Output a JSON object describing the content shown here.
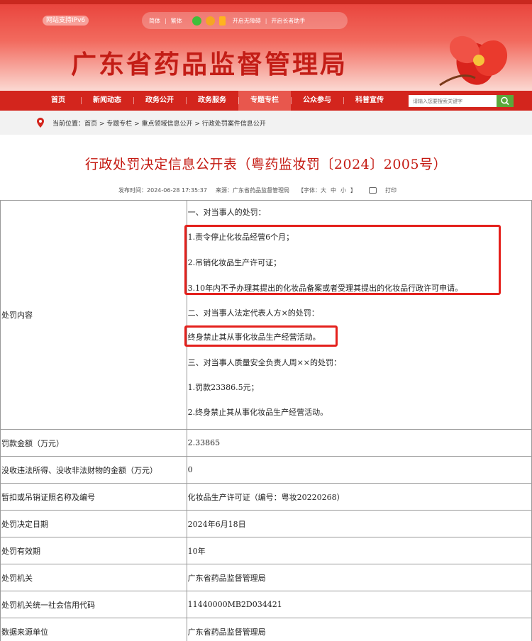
{
  "header": {
    "ipv6_badge": "网站支持IPv6",
    "lang_simplified": "简体",
    "lang_traditional": "繁体",
    "accessibility": "开启无障碍",
    "elder_mode": "开启长者助手",
    "site_title": "广东省药品监督管理局",
    "icons": [
      "wechat-icon",
      "weibo-icon",
      "mobile-icon"
    ]
  },
  "nav": {
    "items": [
      "首页",
      "新闻动态",
      "政务公开",
      "政务服务",
      "专题专栏",
      "公众参与",
      "科普宣传"
    ],
    "active": "专题专栏",
    "search_placeholder": "请输入您要搜索关键字"
  },
  "breadcrumb": {
    "prefix": "当前位置：",
    "trail": "首页 > 专题专栏 > 重点领域信息公开 > 行政处罚案件信息公开"
  },
  "article": {
    "title": "行政处罚决定信息公开表（粤药监妆罚〔2024〕2005号）",
    "publish_time": "发布时间：2024-06-28 17:35:37",
    "source": "来源：广东省药品监督管理局",
    "font_label": "【字体：",
    "font_large": "大",
    "font_medium": "中",
    "font_small": "小",
    "font_close": "】",
    "print": "打印"
  },
  "punishment": {
    "label": "处罚内容",
    "lines": [
      "一、对当事人的处罚：",
      "1.责令停止化妆品经营6个月；",
      "2.吊销化妆品生产许可证；",
      "3.10年内不予办理其提出的化妆品备案或者受理其提出的化妆品行政许可申请。",
      "二、对当事人法定代表人方×的处罚：",
      "终身禁止其从事化妆品生产经营活动。",
      "三、对当事人质量安全负责人周××的处罚：",
      "1.罚款23386.5元；",
      "2.终身禁止其从事化妆品生产经营活动。"
    ]
  },
  "rows": [
    {
      "label": "罚款金额（万元）",
      "value": "2.33865"
    },
    {
      "label": "没收违法所得、没收非法财物的金额（万元）",
      "value": "0"
    },
    {
      "label": "暂扣或吊销证照名称及编号",
      "value": "化妆品生产许可证（编号：粤妆20220268）"
    },
    {
      "label": "处罚决定日期",
      "value": "2024年6月18日"
    },
    {
      "label": "处罚有效期",
      "value": "10年"
    },
    {
      "label": "处罚机关",
      "value": "广东省药品监督管理局"
    },
    {
      "label": "处罚机关统一社会信用代码",
      "value": "11440000MB2D034421"
    },
    {
      "label": "数据来源单位",
      "value": "广东省药品监督管理局"
    }
  ],
  "colors": {
    "brand_red": "#c31d16",
    "nav_red": "#d3251d",
    "highlight": "#e4201c",
    "search_btn": "#5aa83a"
  }
}
